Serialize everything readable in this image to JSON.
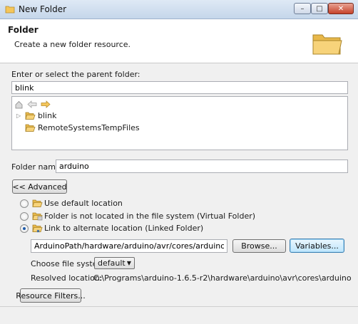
{
  "window": {
    "title": "New Folder",
    "minimize_symbol": "–",
    "maximize_symbol": "□",
    "close_symbol": "✕"
  },
  "banner": {
    "title": "Folder",
    "description": "Create a new folder resource."
  },
  "parent": {
    "label": "Enter or select the parent folder:",
    "value": "blink"
  },
  "tree": {
    "expand_symbol": "▷",
    "items": [
      {
        "label": "blink"
      },
      {
        "label": "RemoteSystemsTempFiles"
      }
    ]
  },
  "folder_name": {
    "label": "Folder name:",
    "value": "arduino"
  },
  "advanced_button": "<< Advanced",
  "location_options": [
    {
      "label": "Use default location",
      "checked": false
    },
    {
      "label": "Folder is not located in the file system (Virtual Folder)",
      "checked": false
    },
    {
      "label": "Link to alternate location (Linked Folder)",
      "checked": true
    }
  ],
  "link": {
    "path_value": "ArduinoPath/hardware/arduino/avr/cores/arduino",
    "browse_label": "Browse...",
    "variables_label": "Variables...",
    "filesystem_label": "Choose file system:",
    "filesystem_value": "default",
    "resolved_label": "Resolved location:",
    "resolved_value": "C:\\Programs\\arduino-1.6.5-r2\\hardware\\arduino\\avr\\cores\\arduino"
  },
  "resource_filters_label": "Resource Filters...",
  "icons": [
    "folder-icon",
    "home-icon",
    "back-arrow-icon",
    "forward-arrow-icon",
    "link-folder-icon"
  ],
  "colors": {
    "accent": "#1e5aa8",
    "folder": "#f5c65a"
  }
}
